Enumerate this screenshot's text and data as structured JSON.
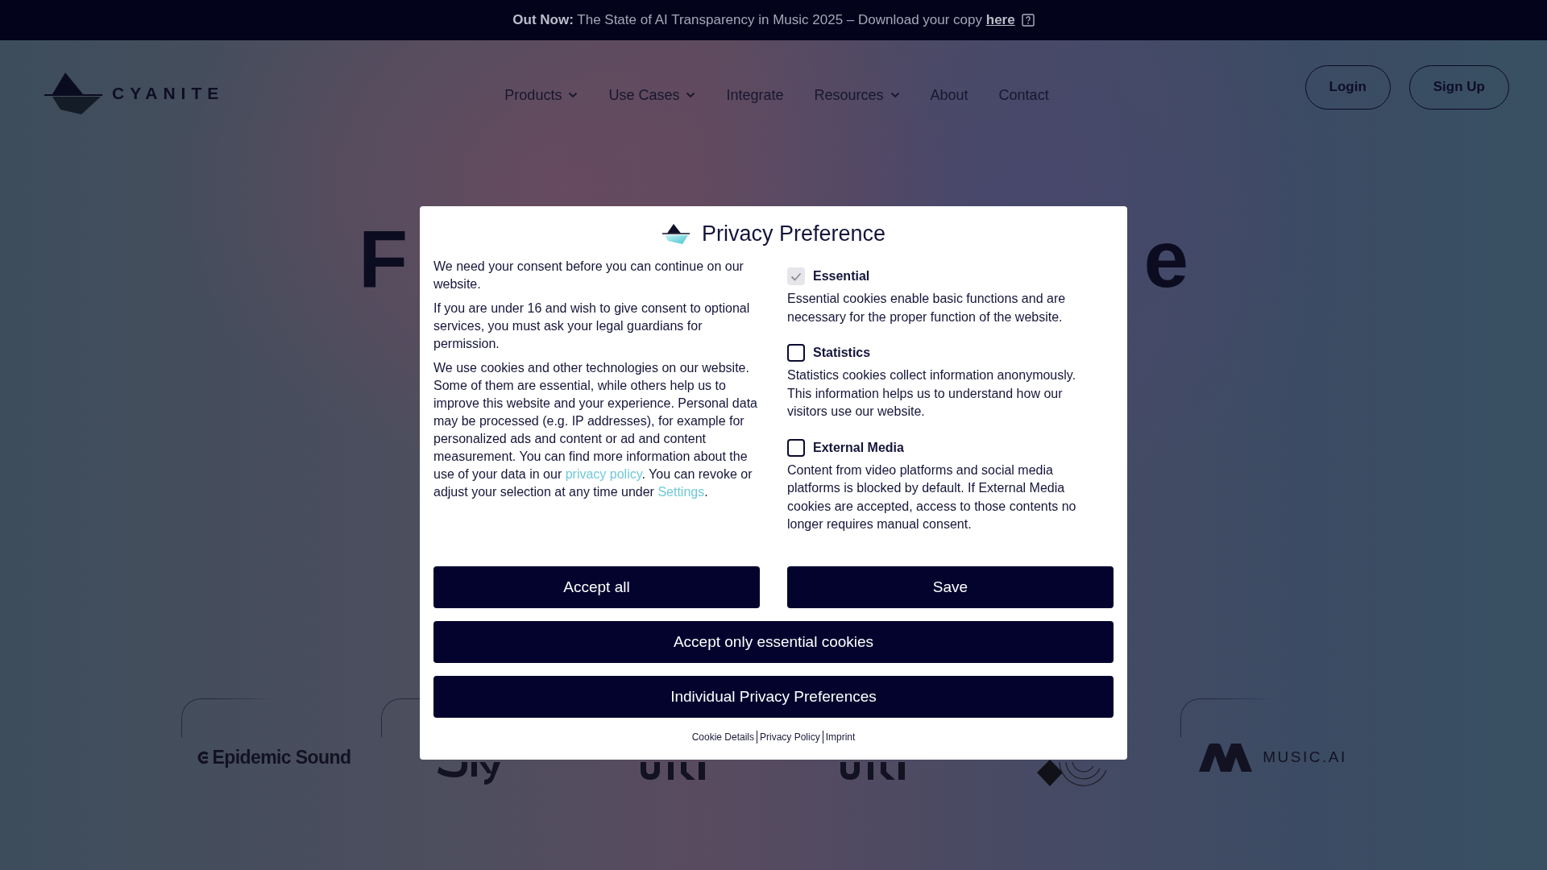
{
  "announcement": {
    "text": "**Out Now:** The State of AI Transparency in Music 2025 – Download your copy",
    "link": "here"
  },
  "header": {
    "logo": "CYANITE",
    "nav": [
      {
        "label": "Products",
        "dropdown": true
      },
      {
        "label": "Use Cases",
        "dropdown": true
      },
      {
        "label": "Integrate",
        "dropdown": false
      },
      {
        "label": "Resources",
        "dropdown": true
      },
      {
        "label": "About",
        "dropdown": false
      },
      {
        "label": "Contact",
        "dropdown": false
      }
    ],
    "actions": [
      "Login",
      "Sign Up"
    ]
  },
  "hero": {
    "heading_left_fragment": "F",
    "heading_right_fragment": "e"
  },
  "logos": [
    {
      "kind": "swirl",
      "text": "Epidemic Sound"
    },
    {
      "kind": "hook"
    },
    {
      "kind": "bars"
    },
    {
      "kind": "bars"
    },
    {
      "kind": "disc"
    },
    {
      "kind": "peaks",
      "text": "MUSIC.AI"
    }
  ],
  "consent_dialog": {
    "title": "Privacy Preference",
    "paragraphs": [
      {
        "segments": [
          {
            "kind": "text",
            "text": "We need your consent before you can continue on our website."
          }
        ]
      },
      {
        "segments": [
          {
            "kind": "text",
            "text": "If you are under 16 and wish to give consent to optional services, you must ask your legal guardians for permission."
          }
        ]
      },
      {
        "segments": [
          {
            "kind": "text",
            "text": "We use cookies and other technologies on our website. Some of them are essential, while others help us to improve this website and your experience. Personal data may be processed (e.g. IP addresses), for example for personalized ads and content or ad and content measurement. You can find more information about the use of your data in our "
          },
          {
            "kind": "link",
            "text": "privacy policy"
          },
          {
            "kind": "text",
            "text": ". You can revoke or adjust your selection at any time under "
          },
          {
            "kind": "link",
            "text": "Settings"
          },
          {
            "kind": "text",
            "text": "."
          }
        ]
      }
    ],
    "categories": [
      {
        "label": "Essential",
        "checked": true,
        "disabled": true,
        "description": "Essential cookies enable basic functions and are necessary for the proper function of the website."
      },
      {
        "label": "Statistics",
        "checked": false,
        "disabled": false,
        "description": "Statistics cookies collect information anonymously. This information helps us to understand how our visitors use our website."
      },
      {
        "label": "External Media",
        "checked": false,
        "disabled": false,
        "description": "Content from video platforms and social media platforms is blocked by default. If External Media cookies are accepted, access to those contents no longer requires manual consent."
      }
    ],
    "button_row": [
      "Accept all",
      "Save"
    ],
    "buttons": [
      "Accept only essential cookies",
      "Individual Privacy Preferences"
    ],
    "footer_links": [
      "Cookie Details",
      "Privacy Policy",
      "Imprint"
    ]
  }
}
